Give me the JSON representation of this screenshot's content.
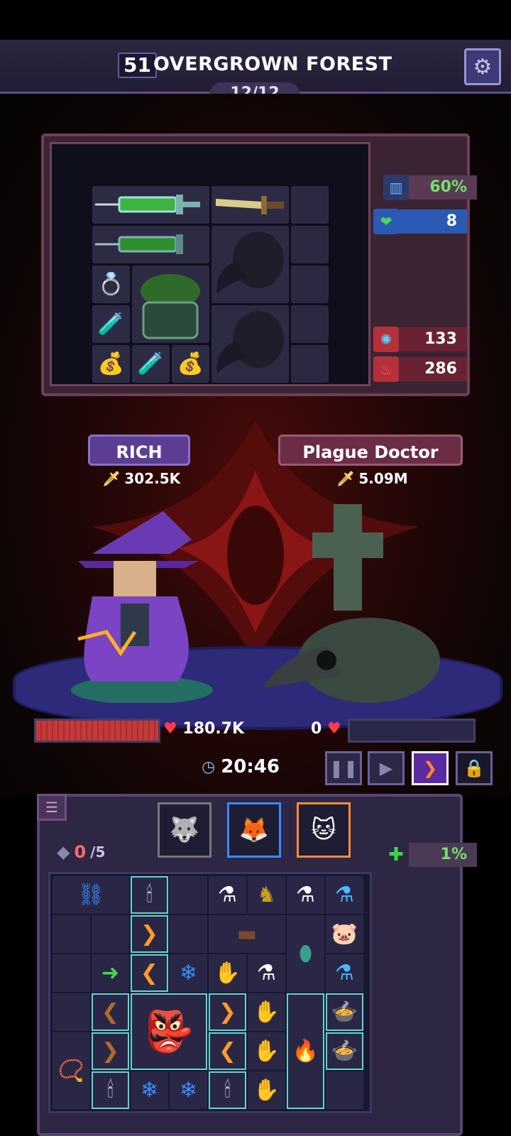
{
  "header": {
    "level": "51",
    "title": "OVERGROWN FOREST",
    "progress": "12/12",
    "settings_icon": "gear-icon"
  },
  "enemy_panel": {
    "stats": [
      {
        "name": "crit-chance",
        "icon": "shield-stack-icon",
        "value": "60%",
        "color": "#73e26a"
      },
      {
        "name": "armor",
        "icon": "heart-shield-icon",
        "value": "8",
        "color": "#ffffff"
      },
      {
        "name": "regen",
        "icon": "gear-orb-icon",
        "value": "133",
        "color": "#ffffff"
      },
      {
        "name": "damage",
        "icon": "fire-icon",
        "value": "286",
        "color": "#ffffff"
      }
    ],
    "items": [
      {
        "name": "syringe-item",
        "glyph": "💉"
      },
      {
        "name": "dagger-item",
        "glyph": "🗡"
      },
      {
        "name": "plague-mask-item",
        "glyph": "🐦"
      },
      {
        "name": "ring-item",
        "glyph": "💍"
      },
      {
        "name": "plant-jar-item",
        "glyph": "🌿"
      },
      {
        "name": "potion-bag-item",
        "glyph": "🧪"
      },
      {
        "name": "coin-bag-item",
        "glyph": "💰"
      }
    ]
  },
  "player": {
    "name": "RICH",
    "power": "302.5K",
    "hp": "180.7K",
    "hp_fraction": 1.0
  },
  "enemy": {
    "name": "Plague Doctor",
    "power": "5.09M",
    "hp": "0",
    "hp_fraction": 0.0
  },
  "battle": {
    "timer": "20:46",
    "pause_icon": "pause-icon",
    "play_icon": "play-icon",
    "fast_icon": "fast-forward-icon",
    "lock_icon": "lock-icon"
  },
  "player_bag": {
    "slots_used": "0",
    "slots_total": "/5",
    "bonus": "1%",
    "hero_tabs": [
      "wolf-hero-tab",
      "ice-fox-hero-tab",
      "cat-hero-tab"
    ]
  }
}
